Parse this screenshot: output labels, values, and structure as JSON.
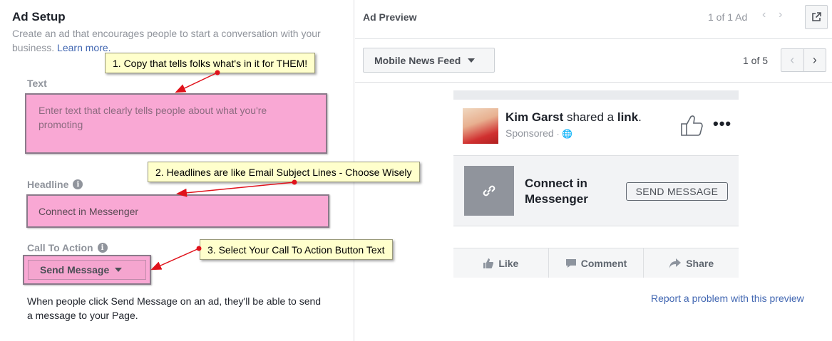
{
  "setup": {
    "title": "Ad Setup",
    "subtitle": "Create an ad that encourages people to start a conversation with your business.",
    "learn_more": "Learn more.",
    "text_label": "Text",
    "text_placeholder": "Enter text that clearly tells people about what you're promoting",
    "headline_label": "Headline",
    "headline_value": "Connect in Messenger",
    "cta_label": "Call To Action",
    "cta_value": "Send Message",
    "cta_description": "When people click Send Message on an ad, they'll be able to send a message to your Page."
  },
  "callouts": {
    "c1": "1. Copy that tells folks what's in it for THEM!",
    "c2": "2. Headlines are like Email Subject Lines - Choose Wisely",
    "c3": "3. Select Your Call To Action Button Text"
  },
  "preview": {
    "title": "Ad Preview",
    "ad_count": "1 of 1 Ad",
    "placement": "Mobile News Feed",
    "page_count": "1 of 5",
    "report_link": "Report a problem with this preview"
  },
  "post": {
    "poster_name": "Kim Garst",
    "shared_text": " shared a ",
    "link_word": "link",
    "period": ".",
    "sponsored": "Sponsored",
    "link_title": "Connect in Messenger",
    "button_label": "SEND MESSAGE",
    "actions": [
      "Like",
      "Comment",
      "Share"
    ]
  },
  "colors": {
    "callout_bg": "#ffffcc",
    "highlight_pink": "#f9a8d4",
    "arrow_red": "#e0121b",
    "link_blue": "#4267b2"
  }
}
